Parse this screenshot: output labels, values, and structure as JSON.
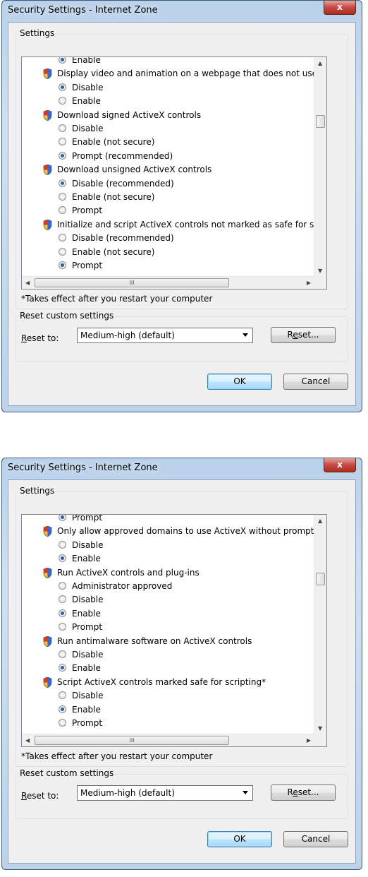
{
  "dialogs": [
    {
      "title": "Security Settings - Internet Zone",
      "close_label": "x",
      "settings_group_label": "Settings",
      "rows": [
        {
          "type": "radio",
          "label": "Enable",
          "checked": true
        },
        {
          "type": "header",
          "label": "Display video and animation on a webpage that does not use"
        },
        {
          "type": "radio",
          "label": "Disable",
          "checked": true
        },
        {
          "type": "radio",
          "label": "Enable",
          "checked": false
        },
        {
          "type": "header",
          "label": "Download signed ActiveX controls"
        },
        {
          "type": "radio",
          "label": "Disable",
          "checked": false
        },
        {
          "type": "radio",
          "label": "Enable (not secure)",
          "checked": false
        },
        {
          "type": "radio",
          "label": "Prompt (recommended)",
          "checked": true
        },
        {
          "type": "header",
          "label": "Download unsigned ActiveX controls"
        },
        {
          "type": "radio",
          "label": "Disable (recommended)",
          "checked": true
        },
        {
          "type": "radio",
          "label": "Enable (not secure)",
          "checked": false
        },
        {
          "type": "radio",
          "label": "Prompt",
          "checked": false
        },
        {
          "type": "header",
          "label": "Initialize and script ActiveX controls not marked as safe for sc"
        },
        {
          "type": "radio",
          "label": "Disable (recommended)",
          "checked": false
        },
        {
          "type": "radio",
          "label": "Enable (not secure)",
          "checked": false
        },
        {
          "type": "radio",
          "label": "Prompt",
          "checked": true
        }
      ],
      "hscroll_thumb_label": "III",
      "note": "*Takes effect after you restart your computer",
      "reset_group_label": "Reset custom settings",
      "reset_to_label": "Reset to:",
      "reset_select_value": "Medium-high (default)",
      "reset_button_label": "Reset...",
      "ok_label": "OK",
      "cancel_label": "Cancel"
    },
    {
      "title": "Security Settings - Internet Zone",
      "close_label": "x",
      "settings_group_label": "Settings",
      "rows": [
        {
          "type": "radio",
          "label": "Prompt",
          "checked": true
        },
        {
          "type": "header",
          "label": "Only allow approved domains to use ActiveX without prompt"
        },
        {
          "type": "radio",
          "label": "Disable",
          "checked": false
        },
        {
          "type": "radio",
          "label": "Enable",
          "checked": true
        },
        {
          "type": "header",
          "label": "Run ActiveX controls and plug-ins"
        },
        {
          "type": "radio",
          "label": "Administrator approved",
          "checked": false
        },
        {
          "type": "radio",
          "label": "Disable",
          "checked": false
        },
        {
          "type": "radio",
          "label": "Enable",
          "checked": true
        },
        {
          "type": "radio",
          "label": "Prompt",
          "checked": false
        },
        {
          "type": "header",
          "label": "Run antimalware software on ActiveX controls"
        },
        {
          "type": "radio",
          "label": "Disable",
          "checked": false
        },
        {
          "type": "radio",
          "label": "Enable",
          "checked": true
        },
        {
          "type": "header",
          "label": "Script ActiveX controls marked safe for scripting*"
        },
        {
          "type": "radio",
          "label": "Disable",
          "checked": false
        },
        {
          "type": "radio",
          "label": "Enable",
          "checked": true
        },
        {
          "type": "radio",
          "label": "Prompt",
          "checked": false
        }
      ],
      "hscroll_thumb_label": "III",
      "note": "*Takes effect after you restart your computer",
      "reset_group_label": "Reset custom settings",
      "reset_to_label": "Reset to:",
      "reset_select_value": "Medium-high (default)",
      "reset_button_label": "Reset...",
      "ok_label": "OK",
      "cancel_label": "Cancel"
    }
  ]
}
